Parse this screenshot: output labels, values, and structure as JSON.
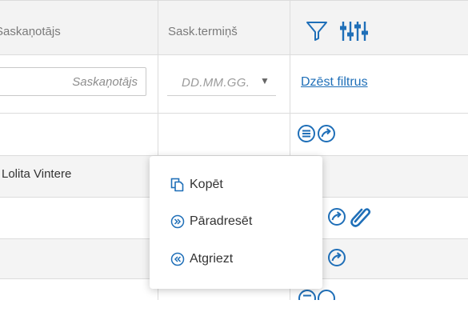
{
  "table": {
    "columns": {
      "approver": "Saskaņotājs",
      "deadline": "Sask.termiņš"
    },
    "filters": {
      "approver_placeholder": "Saskaņotājs",
      "deadline_placeholder": "DD.MM.GG.",
      "clear_filters": "Dzēst filtrus"
    },
    "rows": [
      {
        "approver": ""
      },
      {
        "approver": "Lolita Vintere"
      },
      {
        "approver": ""
      },
      {
        "approver": ""
      }
    ]
  },
  "context_menu": {
    "items": [
      {
        "label": "Kopēt",
        "icon": "copy-icon"
      },
      {
        "label": "Pāradresēt",
        "icon": "forward-icon"
      },
      {
        "label": "Atgriezt",
        "icon": "return-icon"
      }
    ]
  },
  "colors": {
    "accent": "#1f6fb8",
    "header_bg": "#f3f3f3",
    "row_stripe": "#f4f4f4",
    "grid_line": "#dcdcdc"
  }
}
